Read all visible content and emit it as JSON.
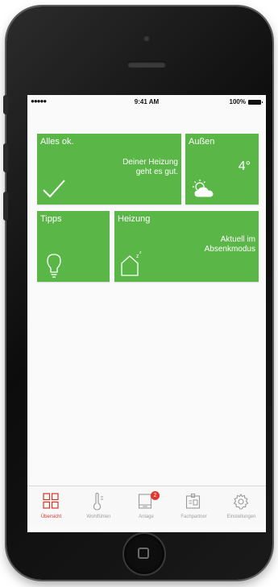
{
  "status_bar": {
    "signal": "●●●●● ",
    "time": "9:41 AM",
    "battery": "100%"
  },
  "tiles": {
    "status": {
      "title": "Alles ok.",
      "message_line1": "Deiner Heizung",
      "message_line2": "geht es gut."
    },
    "outside": {
      "title": "Außen",
      "temperature": "4°"
    },
    "tips": {
      "title": "Tipps"
    },
    "heating": {
      "title": "Heizung",
      "message_line1": "Aktuell im",
      "message_line2": "Absenkmodus"
    }
  },
  "tabs": [
    {
      "label": "Übersicht",
      "icon": "grid-icon"
    },
    {
      "label": "Wohlfühlen",
      "icon": "thermometer-icon"
    },
    {
      "label": "Anlage",
      "icon": "device-icon",
      "badge": "2"
    },
    {
      "label": "Fachpartner",
      "icon": "id-card-icon"
    },
    {
      "label": "Einstellungen",
      "icon": "gear-icon"
    }
  ],
  "colors": {
    "tile_green": "#5ab647",
    "active_red": "#d8332b",
    "badge_red": "#e2352d"
  }
}
